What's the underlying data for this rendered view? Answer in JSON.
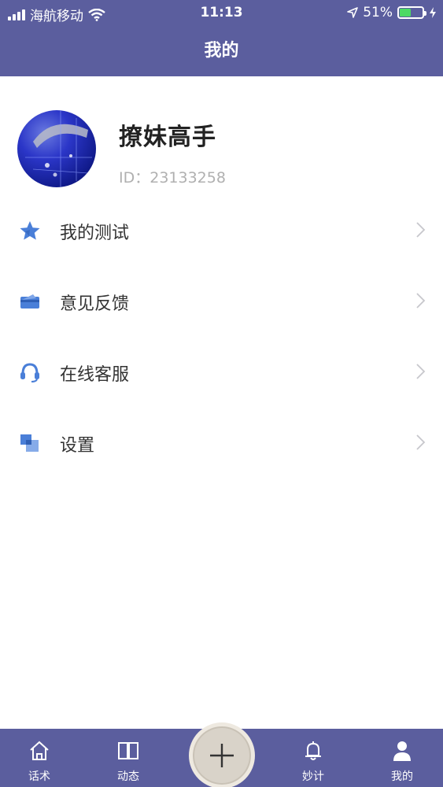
{
  "status_bar": {
    "carrier": "海航移动",
    "time": "11:13",
    "battery": "51%",
    "battery_level": 0.51
  },
  "header": {
    "title": "我的"
  },
  "profile": {
    "name": "撩妹高手",
    "id_text": "ID：23133258"
  },
  "menu": [
    {
      "label": "我的测试",
      "icon": "star-icon"
    },
    {
      "label": "意见反馈",
      "icon": "feedback-card-icon"
    },
    {
      "label": "在线客服",
      "icon": "headset-icon"
    },
    {
      "label": "设置",
      "icon": "squares-icon"
    }
  ],
  "tabbar": [
    {
      "label": "话术",
      "icon": "home-icon"
    },
    {
      "label": "动态",
      "icon": "book-icon"
    },
    {
      "label": "妙计",
      "icon": "bell-icon"
    },
    {
      "label": "我的",
      "icon": "person-icon"
    }
  ],
  "colors": {
    "brand": "#5b5e9e",
    "icon_blue": "#4a7fd8",
    "battery": "#4cd964"
  }
}
